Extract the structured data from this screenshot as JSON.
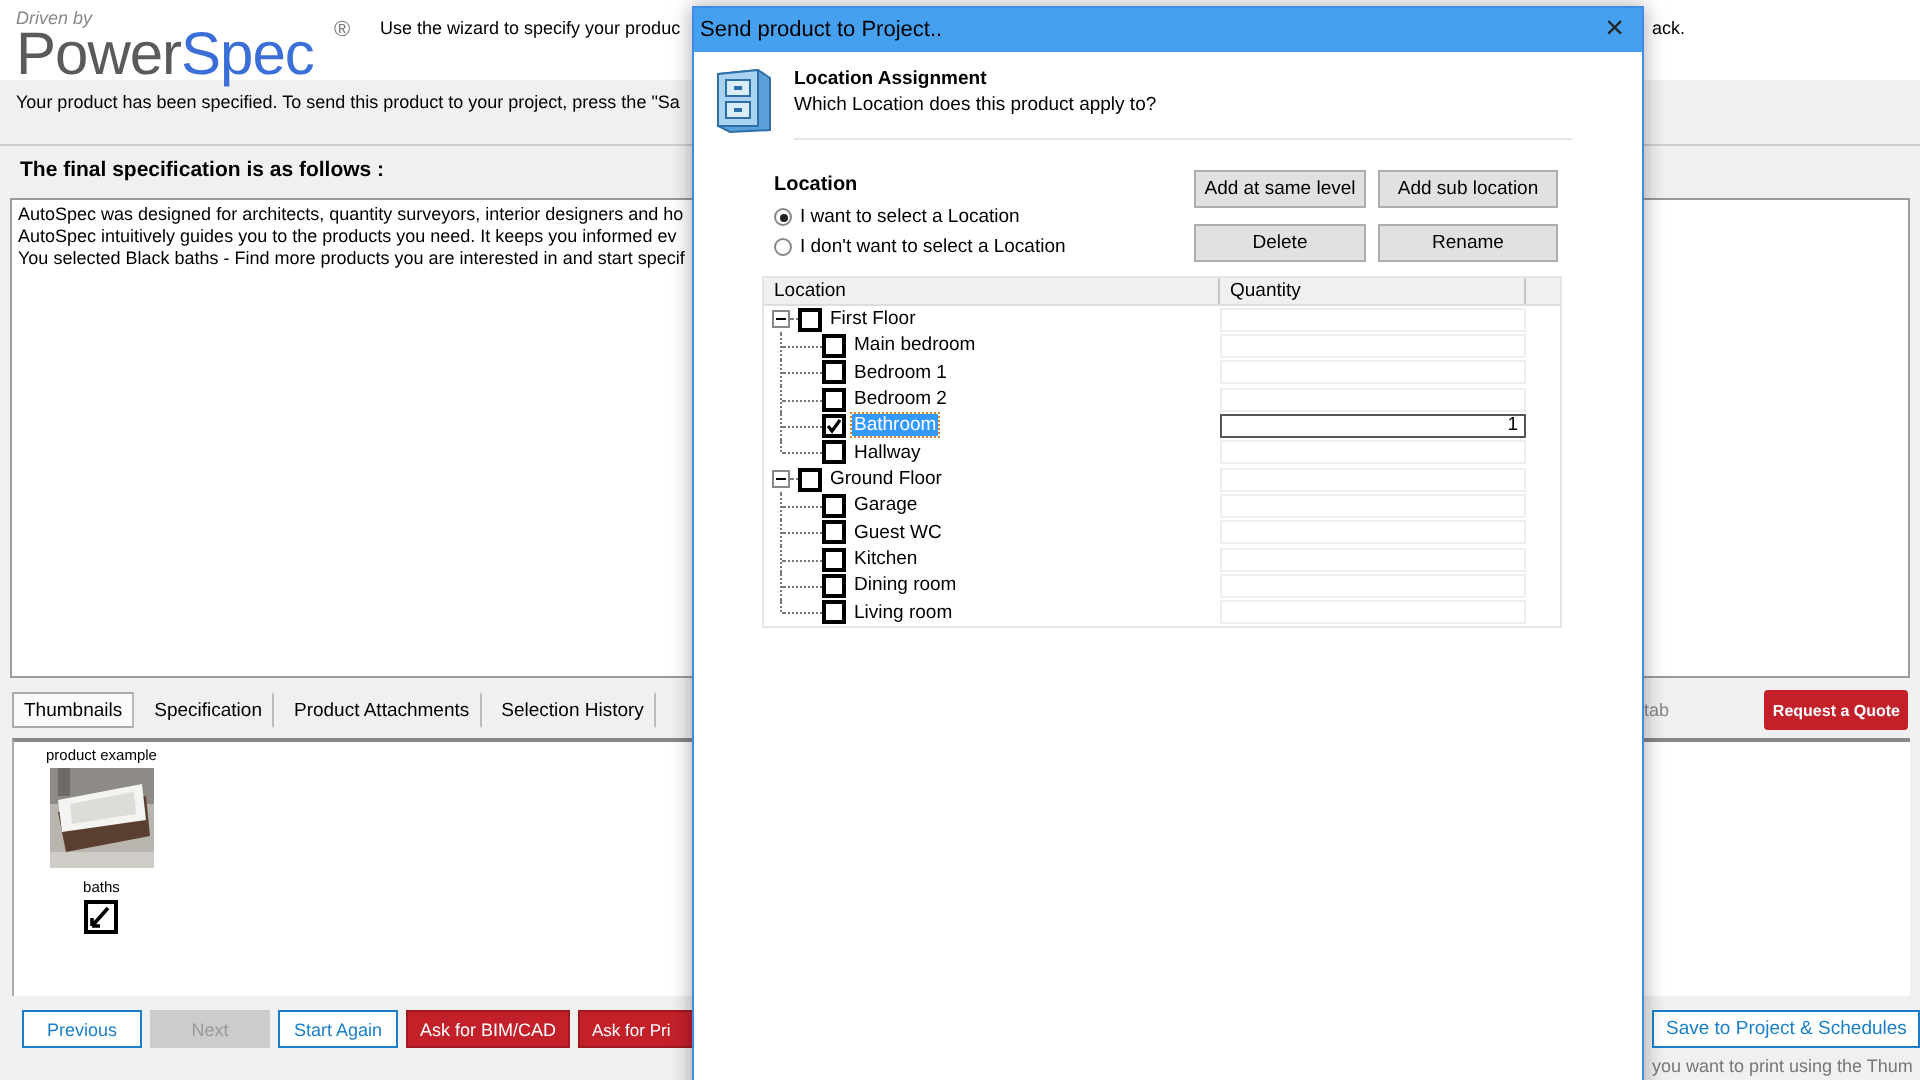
{
  "header": {
    "tagline": "Driven by",
    "logo_part_1": "Power",
    "logo_part_2": "Spec",
    "logo_mark": "®",
    "instruction_start": "Use the wizard to specify your produc",
    "instruction_end": "ack."
  },
  "notice": "Your product has been specified. To send this product to your project, press the \"Sa",
  "spec_heading": "The final specification is as follows :",
  "spec_lines": [
    "AutoSpec was designed for architects, quantity surveyors, interior designers and ho",
    "AutoSpec intuitively guides you to the products you need. It keeps you informed ev",
    "You selected Black baths - Find more products you are interested in and start specif"
  ],
  "tabs": [
    {
      "label": "Thumbnails",
      "selected": true
    },
    {
      "label": "Specification",
      "selected": false
    },
    {
      "label": "Product Attachments",
      "selected": false
    },
    {
      "label": "Selection History",
      "selected": false
    }
  ],
  "tab_hint": "tab",
  "quote_button": "Request a Quote",
  "thumbnails": [
    {
      "title": "product example",
      "kind": "picture",
      "caption": "baths",
      "checked": true
    }
  ],
  "nav_buttons": [
    {
      "label": "Previous",
      "kind": "outline",
      "disabled": false
    },
    {
      "label": "Next",
      "kind": "outline",
      "disabled": true
    },
    {
      "label": "Start Again",
      "kind": "outline",
      "disabled": false
    },
    {
      "label": "Ask for BIM/CAD",
      "kind": "red",
      "disabled": false
    },
    {
      "label": "Ask for Pri",
      "kind": "red",
      "disabled": false
    }
  ],
  "save_button": "Save to Project & Schedules",
  "footer_hint": "you want to print using the Thum",
  "dialog": {
    "title": "Send product to Project..",
    "close": "×",
    "heading": "Location Assignment",
    "subheading": "Which Location does this product apply to?",
    "section_label": "Location",
    "options": [
      {
        "label": "I want to select a Location",
        "selected": true
      },
      {
        "label": "I don't want to select a Location",
        "selected": false
      }
    ],
    "actions": [
      "Add at same level",
      "Add sub location",
      "Delete",
      "Rename"
    ],
    "columns": [
      "Location",
      "Quantity"
    ],
    "tree": [
      {
        "label": "First Floor",
        "checked": false,
        "selected": false,
        "expanded": true,
        "children": [
          {
            "label": "Main bedroom",
            "checked": false,
            "selected": false
          },
          {
            "label": "Bedroom 1",
            "checked": false,
            "selected": false
          },
          {
            "label": "Bedroom 2",
            "checked": false,
            "selected": false
          },
          {
            "label": "Bathroom",
            "checked": true,
            "selected": true,
            "quantity": "1"
          },
          {
            "label": "Hallway",
            "checked": false,
            "selected": false
          }
        ]
      },
      {
        "label": "Ground Floor",
        "checked": false,
        "selected": false,
        "expanded": true,
        "children": [
          {
            "label": "Garage",
            "checked": false,
            "selected": false
          },
          {
            "label": "Guest WC",
            "checked": false,
            "selected": false
          },
          {
            "label": "Kitchen",
            "checked": false,
            "selected": false
          },
          {
            "label": "Dining room",
            "checked": false,
            "selected": false
          },
          {
            "label": "Living room",
            "checked": false,
            "selected": false
          }
        ]
      }
    ]
  }
}
